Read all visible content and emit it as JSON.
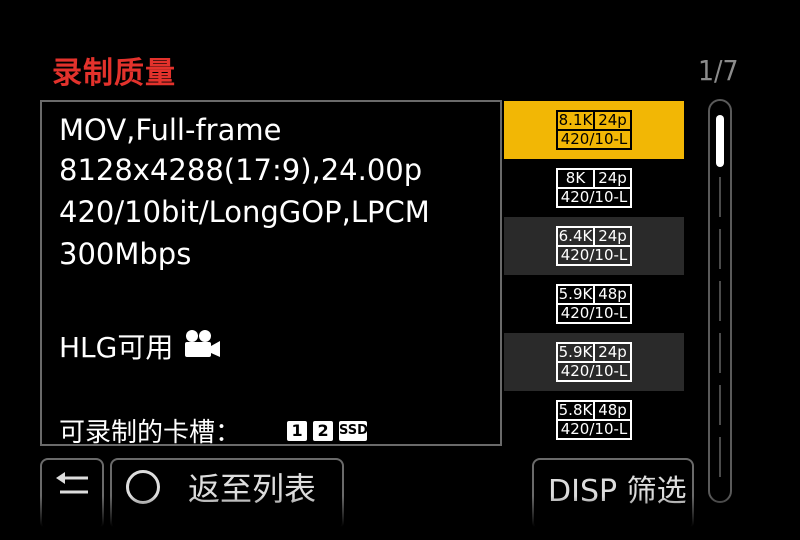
{
  "header": {
    "title": "录制质量",
    "page_indicator": "1/7"
  },
  "details": {
    "line1": "MOV,Full-frame",
    "line2": "8128x4288(17:9),24.00p",
    "line3": "420/10bit/LongGOP,LPCM",
    "line4": "300Mbps",
    "hlg_label": "HLG可用",
    "hlg_icon": "video-camera-icon",
    "slots_label": "可录制的卡槽：",
    "slots": [
      "1",
      "2",
      "SSD"
    ]
  },
  "list": [
    {
      "res": "8.1K",
      "fps": "24p",
      "fmt": "420/10-L",
      "selected": true
    },
    {
      "res": "8K",
      "fps": "24p",
      "fmt": "420/10-L"
    },
    {
      "res": "6.4K",
      "fps": "24p",
      "fmt": "420/10-L"
    },
    {
      "res": "5.9K",
      "fps": "48p",
      "fmt": "420/10-L"
    },
    {
      "res": "5.9K",
      "fps": "24p",
      "fmt": "420/10-L"
    },
    {
      "res": "5.8K",
      "fps": "48p",
      "fmt": "420/10-L"
    }
  ],
  "buttons": {
    "back_icon": "return-icon",
    "list_label": "返至列表",
    "disp_label": "DISP 筛选"
  },
  "colors": {
    "title": "#e3322c",
    "selected_bg": "#f2b705",
    "alt_row_bg": "#2a2a2a",
    "page_indicator": "#8c8c8c"
  }
}
